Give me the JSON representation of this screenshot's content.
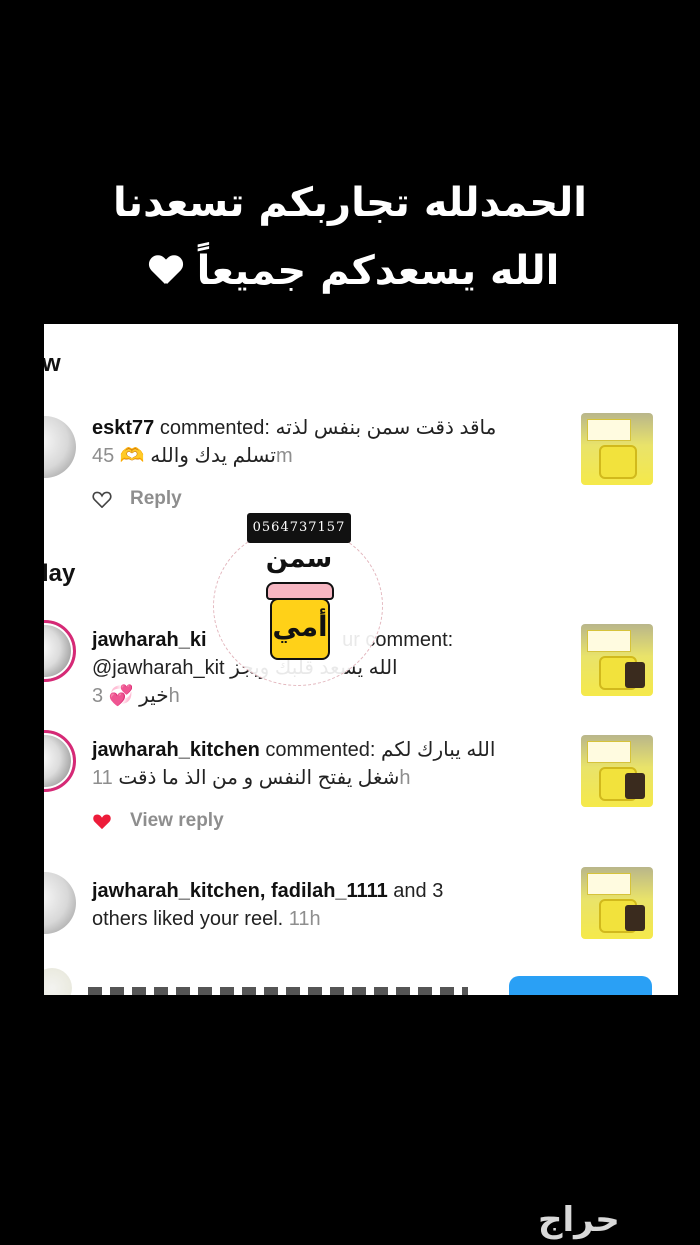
{
  "caption": {
    "line1": "الحمدلله تجاربكم تسعدنا",
    "line2": "الله يسعدكم جميعاً"
  },
  "sections": {
    "top_partial": "w",
    "today_partial": "lay"
  },
  "notifications": [
    {
      "username": "eskt77",
      "action": "commented:",
      "text_line1": "ماقد ذقت سمن بنفس لذته",
      "text_line2": "تسلم يدك والله 🫶",
      "time": "45m",
      "reply_label": "Reply",
      "liked": false
    },
    {
      "username": "jawharah_ki",
      "action": "ur comment:",
      "text_line1": "@jawharah_kit",
      "text_line1b": "الله يسعد قلبك ويجز",
      "text_line2": "خير 💞",
      "time": "3h"
    },
    {
      "username": "jawharah_kitchen",
      "action": "commented:",
      "text_line1": "الله يبارك لكم",
      "text_line2": "شغل يفتح النفس و من الذ ما ذقت",
      "time": "11h",
      "reply_label": "View reply",
      "liked": true
    },
    {
      "usernames": "jawharah_kitchen, fadilah_1111",
      "text_mid": " and 3",
      "text_line2": "others liked your reel.",
      "time": "11h"
    }
  ],
  "logo": {
    "phone": "0564737157",
    "word_top": "سمن",
    "word_jar": "أمي"
  },
  "watermark": "حراج",
  "colors": {
    "like_red": "#ed1c3a",
    "follow_blue": "#2aa0f5",
    "story_ring": "#d62976",
    "secondary_text": "#8e8e8e"
  }
}
